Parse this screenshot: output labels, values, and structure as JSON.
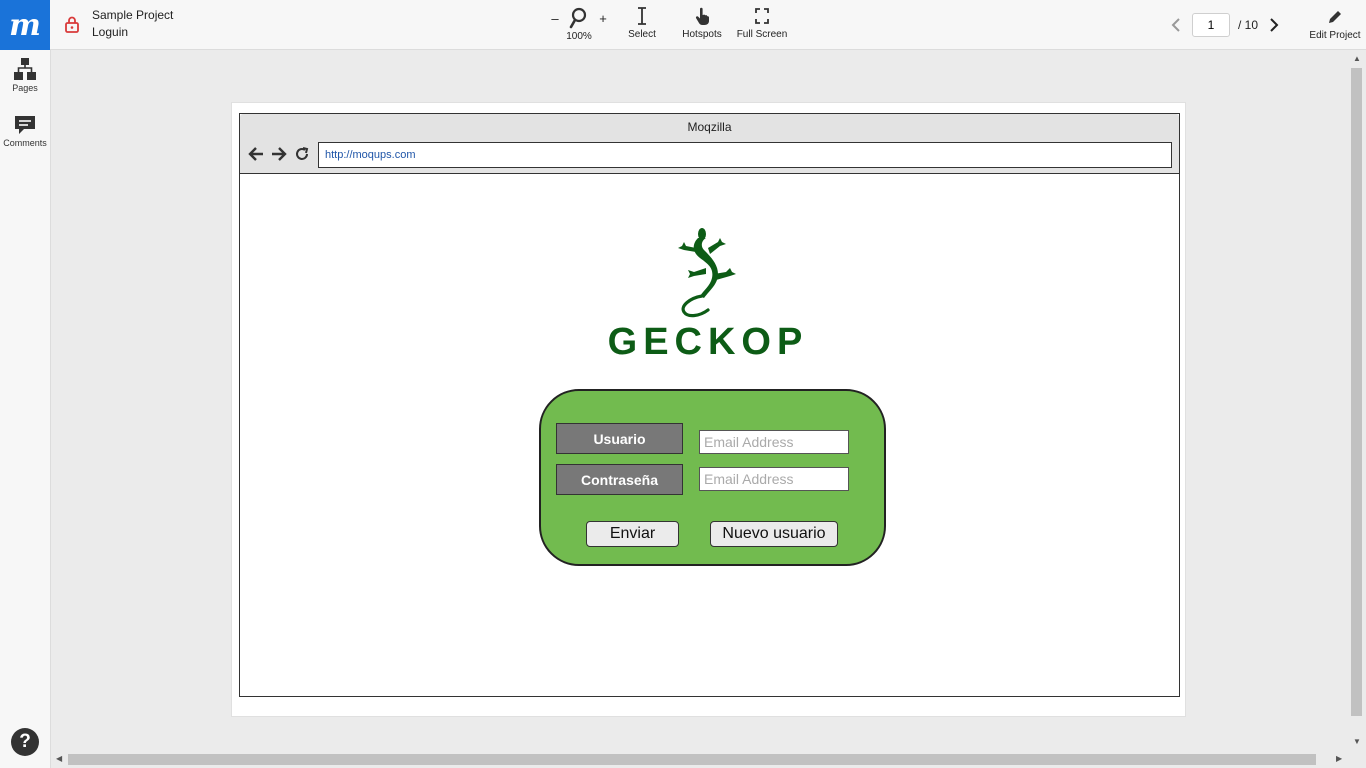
{
  "app": {
    "logo_letter": "m",
    "project_name": "Sample Project",
    "page_name": "Loguin"
  },
  "toolbar": {
    "zoom_minus": "–",
    "zoom_plus": "+",
    "zoom_value": "100%",
    "select_label": "Select",
    "hotspots_label": "Hotspots",
    "fullscreen_label": "Full Screen",
    "edit_label": "Edit Project"
  },
  "pager": {
    "current_page": "1",
    "total_label": "/ 10"
  },
  "sidebar": {
    "items": [
      {
        "label": "Pages",
        "icon": "sitemap-icon"
      },
      {
        "label": "Comments",
        "icon": "comment-icon"
      }
    ],
    "help_label": "?"
  },
  "mockup": {
    "browser_title": "Moqzilla",
    "url": "http://moqups.com",
    "brand_name": "GECKOP",
    "brand_color": "#0d5c16",
    "panel_color": "#72bb4f",
    "form": {
      "user_label": "Usuario",
      "user_placeholder": "Email Address",
      "password_label": "Contraseña",
      "password_placeholder": "Email Address",
      "submit_label": "Enviar",
      "new_user_label": "Nuevo usuario"
    }
  },
  "colors": {
    "accent": "#1a73d9",
    "lock": "#d93a3a"
  }
}
